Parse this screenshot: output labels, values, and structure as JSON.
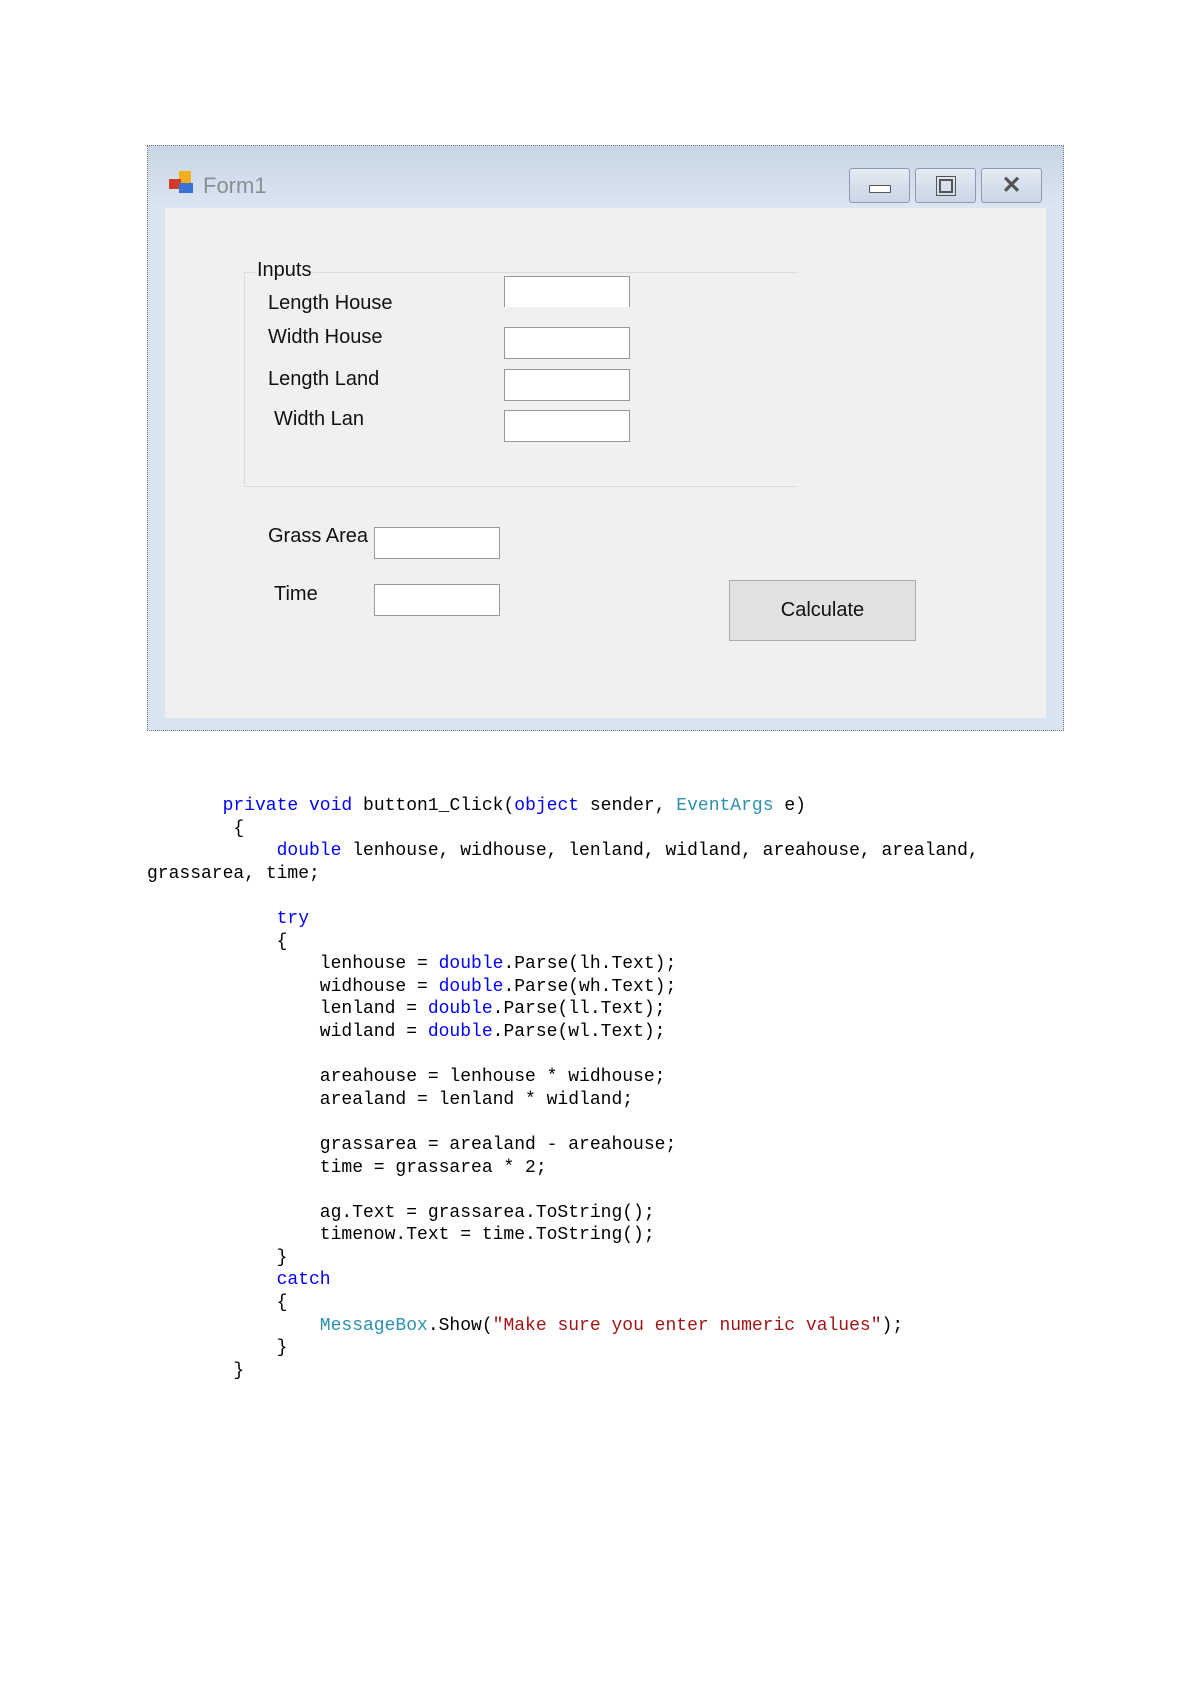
{
  "window": {
    "title": "Form1",
    "controls": {
      "minimize": "minimize-icon",
      "maximize": "maximize-icon",
      "close": "close-icon"
    }
  },
  "form": {
    "group_title": "Inputs",
    "labels": {
      "length_house": "Length House",
      "width_house": "Width House",
      "length_land": "Length Land",
      "width_land": "Width Lan",
      "grass_area": "Grass Area",
      "time": "Time"
    },
    "values": {
      "length_house": "",
      "width_house": "",
      "length_land": "",
      "width_land": "",
      "grass_area": "",
      "time": ""
    },
    "calculate_label": "Calculate"
  },
  "colors": {
    "keyword": "#0000ff",
    "type": "#2b91af",
    "string": "#a31515",
    "text": "#000000"
  },
  "code": [
    {
      "indent": 7,
      "tokens": [
        [
          "private void ",
          "keyword"
        ],
        [
          "button1_Click(",
          "text"
        ],
        [
          "object",
          "keyword"
        ],
        [
          " sender, ",
          "text"
        ],
        [
          "EventArgs",
          "type"
        ],
        [
          " e)",
          "text"
        ]
      ]
    },
    {
      "indent": 8,
      "tokens": [
        [
          "{",
          "text"
        ]
      ]
    },
    {
      "indent": 12,
      "tokens": [
        [
          "double",
          "keyword"
        ],
        [
          " lenhouse, widhouse, lenland, widland, areahouse, arealand,",
          "text"
        ]
      ]
    },
    {
      "indent": 0,
      "tokens": [
        [
          "grassarea, time;",
          "text"
        ]
      ]
    },
    {
      "indent": 0,
      "tokens": []
    },
    {
      "indent": 12,
      "tokens": [
        [
          "try",
          "keyword"
        ]
      ]
    },
    {
      "indent": 12,
      "tokens": [
        [
          "{",
          "text"
        ]
      ]
    },
    {
      "indent": 16,
      "tokens": [
        [
          "lenhouse = ",
          "text"
        ],
        [
          "double",
          "keyword"
        ],
        [
          ".Parse(lh.Text);",
          "text"
        ]
      ]
    },
    {
      "indent": 16,
      "tokens": [
        [
          "widhouse = ",
          "text"
        ],
        [
          "double",
          "keyword"
        ],
        [
          ".Parse(wh.Text);",
          "text"
        ]
      ]
    },
    {
      "indent": 16,
      "tokens": [
        [
          "lenland = ",
          "text"
        ],
        [
          "double",
          "keyword"
        ],
        [
          ".Parse(ll.Text);",
          "text"
        ]
      ]
    },
    {
      "indent": 16,
      "tokens": [
        [
          "widland = ",
          "text"
        ],
        [
          "double",
          "keyword"
        ],
        [
          ".Parse(wl.Text);",
          "text"
        ]
      ]
    },
    {
      "indent": 0,
      "tokens": []
    },
    {
      "indent": 16,
      "tokens": [
        [
          "areahouse = lenhouse * widhouse;",
          "text"
        ]
      ]
    },
    {
      "indent": 16,
      "tokens": [
        [
          "arealand = lenland * widland;",
          "text"
        ]
      ]
    },
    {
      "indent": 0,
      "tokens": []
    },
    {
      "indent": 16,
      "tokens": [
        [
          "grassarea = arealand - areahouse;",
          "text"
        ]
      ]
    },
    {
      "indent": 16,
      "tokens": [
        [
          "time = grassarea * 2;",
          "text"
        ]
      ]
    },
    {
      "indent": 0,
      "tokens": []
    },
    {
      "indent": 16,
      "tokens": [
        [
          "ag.Text = grassarea.ToString();",
          "text"
        ]
      ]
    },
    {
      "indent": 16,
      "tokens": [
        [
          "timenow.Text = time.ToString();",
          "text"
        ]
      ]
    },
    {
      "indent": 12,
      "tokens": [
        [
          "}",
          "text"
        ]
      ]
    },
    {
      "indent": 12,
      "tokens": [
        [
          "catch",
          "keyword"
        ]
      ]
    },
    {
      "indent": 12,
      "tokens": [
        [
          "{",
          "text"
        ]
      ]
    },
    {
      "indent": 16,
      "tokens": [
        [
          "MessageBox",
          "type"
        ],
        [
          ".Show(",
          "text"
        ],
        [
          "\"Make sure you enter numeric values\"",
          "string"
        ],
        [
          ");",
          "text"
        ]
      ]
    },
    {
      "indent": 12,
      "tokens": [
        [
          "}",
          "text"
        ]
      ]
    },
    {
      "indent": 8,
      "tokens": [
        [
          "}",
          "text"
        ]
      ]
    }
  ]
}
